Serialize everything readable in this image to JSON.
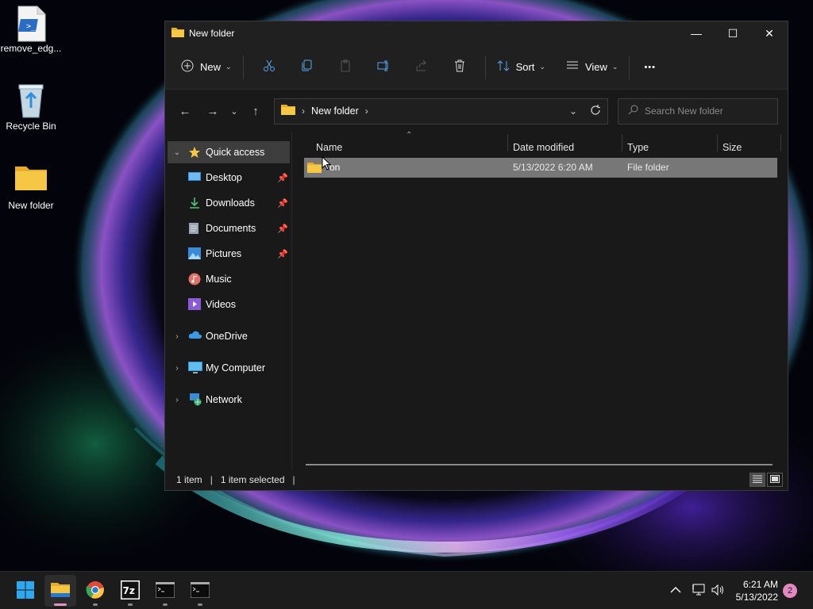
{
  "desktop": {
    "icons": [
      {
        "label": "remove_edg..."
      },
      {
        "label": "Recycle Bin"
      },
      {
        "label": "New folder"
      }
    ]
  },
  "window": {
    "title": "New folder",
    "controls": {
      "minimize": "—",
      "maximize": "☐",
      "close": "✕"
    }
  },
  "toolbar": {
    "new_label": "New",
    "sort_label": "Sort",
    "view_label": "View",
    "more_label": "•••"
  },
  "address": {
    "crumb": "New folder",
    "search_placeholder": "Search New folder"
  },
  "navpane": {
    "quick_access": "Quick access",
    "pinned": [
      {
        "label": "Desktop"
      },
      {
        "label": "Downloads"
      },
      {
        "label": "Documents"
      },
      {
        "label": "Pictures"
      }
    ],
    "recent": [
      {
        "label": "Music"
      },
      {
        "label": "Videos"
      }
    ],
    "onedrive": "OneDrive",
    "my_computer": "My Computer",
    "network": "Network"
  },
  "columns": {
    "name": "Name",
    "date": "Date modified",
    "type": "Type",
    "size": "Size"
  },
  "files": [
    {
      "name": "on",
      "date": "5/13/2022 6:20 AM",
      "type": "File folder",
      "size": ""
    }
  ],
  "status": {
    "count": "1 item",
    "selected": "1 item selected",
    "divider": "|"
  },
  "taskbar": {
    "time": "6:21 AM",
    "date": "5/13/2022",
    "notifications": "2"
  },
  "colors": {
    "accent": "#e88fc5",
    "folder": "#f6c744",
    "selection": "#777777"
  }
}
